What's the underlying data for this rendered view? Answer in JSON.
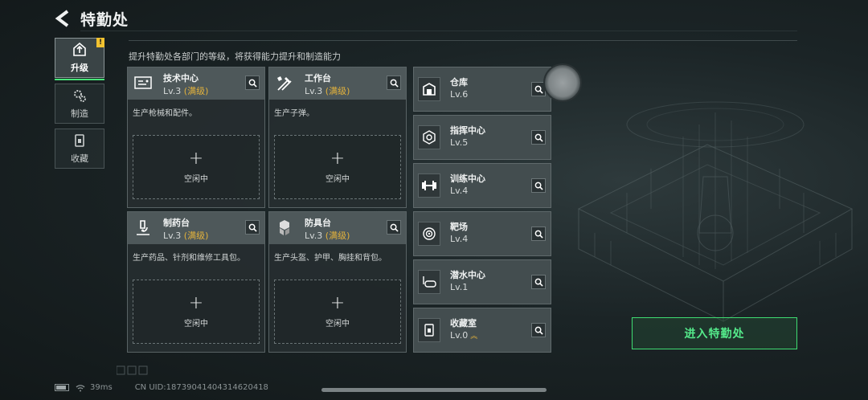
{
  "header": {
    "title": "特勤处",
    "subtitle": "提升特勤处各部门的等级，将获得能力提升和制造能力"
  },
  "nav": [
    {
      "label": "升级",
      "active": true,
      "badge": "!"
    },
    {
      "label": "制造",
      "active": false
    },
    {
      "label": "收藏",
      "active": false
    }
  ],
  "cards": [
    {
      "name": "技术中心",
      "level": "Lv.3",
      "max": "(满级)",
      "desc": "生产枪械和配件。",
      "slot": "空闲中",
      "icon": "tech-center-icon"
    },
    {
      "name": "工作台",
      "level": "Lv.3",
      "max": "(满级)",
      "desc": "生产子弹。",
      "slot": "空闲中",
      "icon": "workbench-icon"
    },
    {
      "name": "制药台",
      "level": "Lv.3",
      "max": "(满级)",
      "desc": "生产药品、针剂和维修工具包。",
      "slot": "空闲中",
      "icon": "pharmacy-icon"
    },
    {
      "name": "防具台",
      "level": "Lv.3",
      "max": "(满级)",
      "desc": "生产头盔、护甲、胸挂和背包。",
      "slot": "空闲中",
      "icon": "armor-bench-icon"
    }
  ],
  "rows": [
    {
      "name": "仓库",
      "level": "Lv.6",
      "icon": "warehouse-icon"
    },
    {
      "name": "指挥中心",
      "level": "Lv.5",
      "icon": "command-center-icon"
    },
    {
      "name": "训练中心",
      "level": "Lv.4",
      "icon": "training-center-icon"
    },
    {
      "name": "靶场",
      "level": "Lv.4",
      "icon": "shooting-range-icon"
    },
    {
      "name": "潜水中心",
      "level": "Lv.1",
      "icon": "diving-center-icon"
    },
    {
      "name": "收藏室",
      "level": "Lv.0",
      "icon": "collection-room-icon",
      "upgradable": true
    }
  ],
  "enter_button": "进入特勤处",
  "status": {
    "ping": "39ms",
    "uid": "CN UID:18739041404314620418"
  },
  "colors": {
    "accent_green": "#49e57a",
    "max_level": "#e3b23c"
  }
}
